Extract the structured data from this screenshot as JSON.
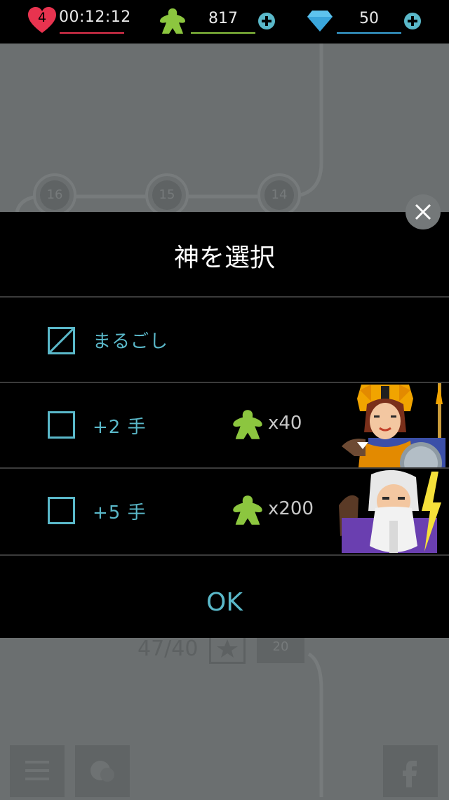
{
  "top_bar": {
    "lives": "4",
    "timer": "00:12:12",
    "meeples": "817",
    "gems": "50",
    "colors": {
      "heart": "#e8334f",
      "meeple": "#8cc63f",
      "gem": "#3aa6dc",
      "plus": "#5ab8c9"
    },
    "icons": [
      "heart-icon",
      "meeple-icon",
      "gem-icon",
      "plus-icon"
    ]
  },
  "map": {
    "nodes": [
      "16",
      "15",
      "14"
    ],
    "progress": "47/40",
    "level_label": "20"
  },
  "dialog": {
    "title": "神を選択",
    "options": [
      {
        "label": "まるごし",
        "checked": "slashed"
      },
      {
        "label": "+2 手",
        "cost": "x40"
      },
      {
        "label": "+5 手",
        "cost": "x200"
      }
    ],
    "ok_label": "OK",
    "colors": {
      "accent": "#5ab8c9",
      "background": "#000000"
    }
  }
}
